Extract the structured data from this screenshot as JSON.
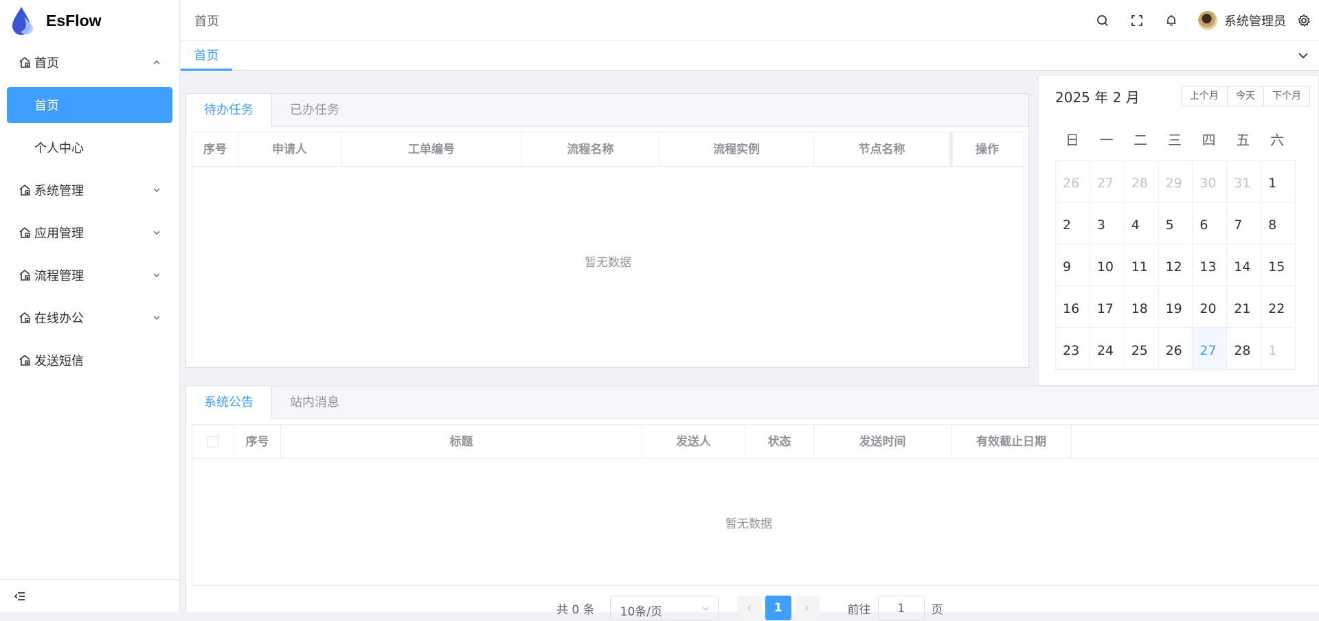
{
  "app": {
    "name": "EsFlow"
  },
  "sidebar": {
    "items": [
      {
        "label": "首页",
        "expanded": true,
        "children": [
          {
            "label": "首页",
            "active": true
          },
          {
            "label": "个人中心"
          }
        ]
      },
      {
        "label": "系统管理"
      },
      {
        "label": "应用管理"
      },
      {
        "label": "流程管理"
      },
      {
        "label": "在线办公"
      },
      {
        "label": "发送短信"
      }
    ]
  },
  "header": {
    "breadcrumb": "首页",
    "user_name": "系统管理员"
  },
  "tags_view": {
    "tags": [
      "首页"
    ]
  },
  "task_panel": {
    "tabs": [
      "待办任务",
      "已办任务"
    ],
    "columns": [
      "序号",
      "申请人",
      "工单编号",
      "流程名称",
      "流程实例",
      "节点名称",
      "操作"
    ],
    "empty_text": "暂无数据"
  },
  "calendar": {
    "title": "2025 年 2 月",
    "buttons": [
      "上个月",
      "今天",
      "下个月"
    ],
    "weekdays": [
      "日",
      "一",
      "二",
      "三",
      "四",
      "五",
      "六"
    ],
    "days": [
      {
        "d": "26",
        "other": true
      },
      {
        "d": "27",
        "other": true
      },
      {
        "d": "28",
        "other": true
      },
      {
        "d": "29",
        "other": true
      },
      {
        "d": "30",
        "other": true
      },
      {
        "d": "31",
        "other": true
      },
      {
        "d": "1"
      },
      {
        "d": "2"
      },
      {
        "d": "3"
      },
      {
        "d": "4"
      },
      {
        "d": "5"
      },
      {
        "d": "6"
      },
      {
        "d": "7"
      },
      {
        "d": "8"
      },
      {
        "d": "9"
      },
      {
        "d": "10"
      },
      {
        "d": "11"
      },
      {
        "d": "12"
      },
      {
        "d": "13"
      },
      {
        "d": "14"
      },
      {
        "d": "15"
      },
      {
        "d": "16"
      },
      {
        "d": "17"
      },
      {
        "d": "18"
      },
      {
        "d": "19"
      },
      {
        "d": "20"
      },
      {
        "d": "21"
      },
      {
        "d": "22"
      },
      {
        "d": "23"
      },
      {
        "d": "24"
      },
      {
        "d": "25"
      },
      {
        "d": "26"
      },
      {
        "d": "27",
        "today": true
      },
      {
        "d": "28"
      },
      {
        "d": "1",
        "other": true
      }
    ]
  },
  "notice_panel": {
    "tabs": [
      "系统公告",
      "站内消息"
    ],
    "columns": [
      "序号",
      "标题",
      "发送人",
      "状态",
      "发送时间",
      "有效截止日期"
    ],
    "empty_text": "暂无数据"
  },
  "pagination": {
    "total_text": "共 0 条",
    "page_size": "10条/页",
    "current_page": "1",
    "goto_label": "前往",
    "goto_value": "1",
    "page_suffix": "页"
  },
  "colors": {
    "accent": "#409eff"
  }
}
